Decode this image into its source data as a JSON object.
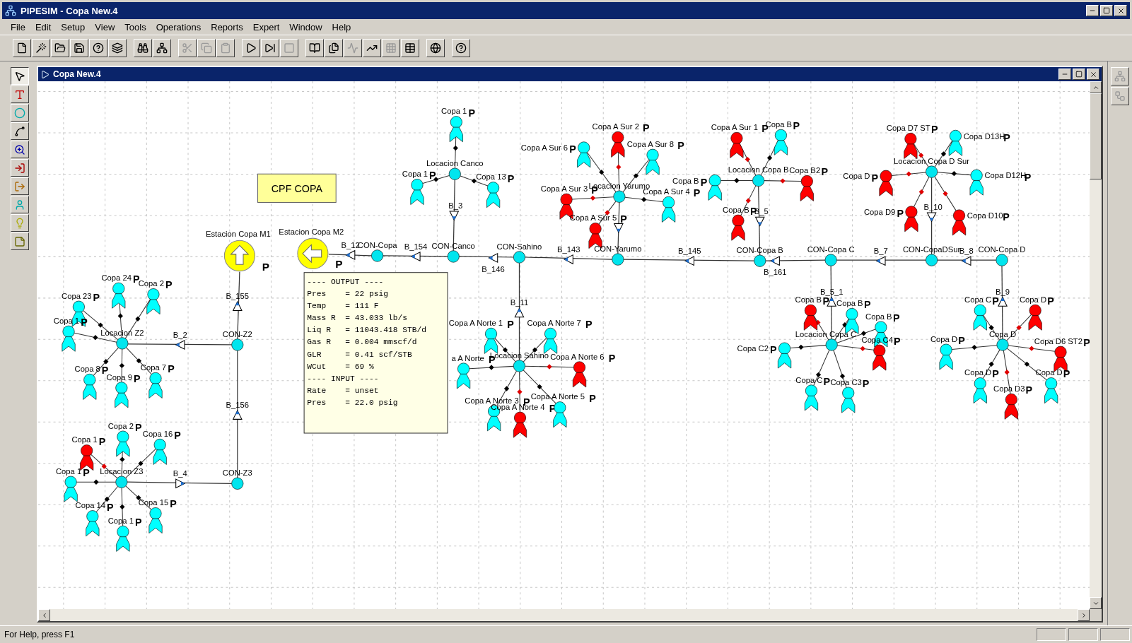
{
  "app_title": "PIPESIM - Copa New.4",
  "menu": [
    "File",
    "Edit",
    "Setup",
    "View",
    "Tools",
    "Operations",
    "Reports",
    "Expert",
    "Window",
    "Help"
  ],
  "toolbar": [
    [
      {
        "kind": "new",
        "disabled": false
      },
      {
        "kind": "wizard",
        "disabled": false
      },
      {
        "kind": "open",
        "disabled": false
      },
      {
        "kind": "save",
        "disabled": false
      },
      {
        "kind": "help-file",
        "disabled": false
      },
      {
        "kind": "layers",
        "disabled": false
      }
    ],
    [
      {
        "kind": "find",
        "disabled": false
      },
      {
        "kind": "network",
        "disabled": false
      }
    ],
    [
      {
        "kind": "cut",
        "disabled": true
      },
      {
        "kind": "copy",
        "disabled": true
      },
      {
        "kind": "paste",
        "disabled": true
      }
    ],
    [
      {
        "kind": "run",
        "disabled": false
      },
      {
        "kind": "run-all",
        "disabled": false
      },
      {
        "kind": "stop",
        "disabled": true
      }
    ],
    [
      {
        "kind": "report",
        "disabled": false
      },
      {
        "kind": "pages",
        "disabled": false
      },
      {
        "kind": "chart",
        "disabled": true
      },
      {
        "kind": "plot",
        "disabled": false
      },
      {
        "kind": "graph",
        "disabled": true
      },
      {
        "kind": "table",
        "disabled": false
      }
    ],
    [
      {
        "kind": "globe",
        "disabled": false
      }
    ],
    [
      {
        "kind": "help",
        "disabled": false
      }
    ]
  ],
  "palette": [
    {
      "kind": "select",
      "selected": true
    },
    {
      "kind": "text",
      "selected": false
    },
    {
      "kind": "node",
      "selected": false
    },
    {
      "kind": "connect",
      "selected": false
    },
    {
      "kind": "zoom",
      "selected": false
    },
    {
      "kind": "source",
      "selected": false
    },
    {
      "kind": "sink",
      "selected": false
    },
    {
      "kind": "well",
      "selected": false
    },
    {
      "kind": "light",
      "selected": false
    },
    {
      "kind": "note",
      "selected": false
    }
  ],
  "right_palette": [
    {
      "kind": "network",
      "disabled": true
    },
    {
      "kind": "tree",
      "disabled": true
    }
  ],
  "document": {
    "title": "Copa New.4",
    "canvas": {
      "note": "CPF COPA",
      "sinks": [
        {
          "label": "Estacion Copa M1",
          "flag": "P",
          "kind": "up"
        },
        {
          "label": "Estacion Copa M2",
          "flag": "P",
          "kind": "left"
        }
      ],
      "junctions": [
        {
          "label": "CON-Copa"
        },
        {
          "label": "CON-Canco"
        },
        {
          "label": "CON-Sahino"
        },
        {
          "label": "CON-Yarumo"
        },
        {
          "label": "CON-Copa B"
        },
        {
          "label": "CON-Copa C"
        },
        {
          "label": "CON-CopaDSur"
        },
        {
          "label": "CON-Copa D"
        },
        {
          "label": "CON-Z2"
        },
        {
          "label": "CON-Z3"
        }
      ],
      "chokes": [
        {
          "label": "B_12"
        },
        {
          "label": "B_154"
        },
        {
          "label": "B_146"
        },
        {
          "label": "B_143"
        },
        {
          "label": "B_145"
        },
        {
          "label": "B_161"
        },
        {
          "label": "B_7"
        },
        {
          "label": "B_8"
        },
        {
          "label": "B_155"
        },
        {
          "label": "B_156"
        },
        {
          "label": "B_2"
        },
        {
          "label": "B_4"
        },
        {
          "label": "B_3"
        },
        {
          "label": "B_11"
        },
        {
          "label": "B_5"
        },
        {
          "label": "B_10"
        },
        {
          "label": "B_5_1"
        },
        {
          "label": "B_9"
        }
      ],
      "clusters": [
        {
          "label": "Locacion Z2",
          "wells": [
            {
              "label": "Copa 24",
              "flag": "P",
              "color": "#00ffff"
            },
            {
              "label": "Copa 2",
              "flag": "P",
              "color": "#00ffff"
            },
            {
              "label": "Copa 23",
              "flag": "P",
              "color": "#00ffff"
            },
            {
              "label": "Copa 1",
              "flag": "P",
              "color": "#00ffff"
            },
            {
              "label": "Copa 8",
              "flag": "P",
              "color": "#00ffff"
            },
            {
              "label": "Copa 9",
              "flag": "P",
              "color": "#00ffff"
            },
            {
              "label": "Copa 7",
              "flag": "P",
              "color": "#00ffff"
            }
          ]
        },
        {
          "label": "Locacion Z3",
          "wells": [
            {
              "label": "Copa 2",
              "flag": "P",
              "color": "#00ffff"
            },
            {
              "label": "Copa 1",
              "flag": "P",
              "color": "#ff0000"
            },
            {
              "label": "Copa 16",
              "flag": "P",
              "color": "#00ffff"
            },
            {
              "label": "Copa 1",
              "flag": "P",
              "color": "#00ffff"
            },
            {
              "label": "Copa 14",
              "flag": "P",
              "color": "#00ffff"
            },
            {
              "label": "Copa 1",
              "flag": "P",
              "color": "#00ffff"
            },
            {
              "label": "Copa 15",
              "flag": "P",
              "color": "#00ffff"
            }
          ]
        },
        {
          "label": "Locacion Canco",
          "wells": [
            {
              "label": "Copa 1",
              "flag": "P",
              "color": "#00ffff"
            },
            {
              "label": "Copa 1",
              "flag": "P",
              "color": "#00ffff"
            },
            {
              "label": "Copa 13",
              "flag": "P",
              "color": "#00ffff"
            }
          ]
        },
        {
          "label": "Locacion Yarumo",
          "wells": [
            {
              "label": "Copa A Sur 6",
              "flag": "P",
              "color": "#00ffff"
            },
            {
              "label": "Copa A Sur 2",
              "flag": "P",
              "color": "#ff0000"
            },
            {
              "label": "Copa A Sur 8",
              "flag": "P",
              "color": "#00ffff"
            },
            {
              "label": "Copa A Sur 3",
              "flag": "P",
              "color": "#ff0000"
            },
            {
              "label": "Copa A Sur 4",
              "flag": "P",
              "color": "#00ffff"
            },
            {
              "label": "Copa A Sur 5",
              "flag": "P",
              "color": "#ff0000"
            }
          ]
        },
        {
          "label": "Locacion Copa B",
          "wells": [
            {
              "label": "Copa A Sur 1",
              "flag": "P",
              "color": "#ff0000"
            },
            {
              "label": "Copa B",
              "flag": "P",
              "color": "#00ffff"
            },
            {
              "label": "Copa B",
              "flag": "P",
              "color": "#00ffff"
            },
            {
              "label": "Copa B2",
              "flag": "P",
              "color": "#ff0000"
            },
            {
              "label": "Copa B",
              "flag": "P",
              "color": "#ff0000"
            }
          ]
        },
        {
          "label": "Locacion Copa D Sur",
          "wells": [
            {
              "label": "Copa D7 ST",
              "flag": "P",
              "color": "#ff0000"
            },
            {
              "label": "Copa D13H",
              "flag": "P",
              "color": "#00ffff"
            },
            {
              "label": "Copa D",
              "flag": "P",
              "color": "#ff0000"
            },
            {
              "label": "Copa D12H",
              "flag": "P",
              "color": "#00ffff"
            },
            {
              "label": "Copa D9",
              "flag": "P",
              "color": "#ff0000"
            },
            {
              "label": "Copa D10",
              "flag": "P",
              "color": "#ff0000"
            }
          ]
        },
        {
          "label": "Locacion Copa C",
          "wells": [
            {
              "label": "Copa B",
              "flag": "P",
              "color": "#ff0000"
            },
            {
              "label": "Copa B",
              "flag": "P",
              "color": "#00ffff"
            },
            {
              "label": "Copa B",
              "flag": "P",
              "color": "#00ffff"
            },
            {
              "label": "Copa C4",
              "flag": "P",
              "color": "#ff0000"
            },
            {
              "label": "Copa C2",
              "flag": "P",
              "color": "#00ffff"
            },
            {
              "label": "Copa C",
              "flag": "P",
              "color": "#00ffff"
            },
            {
              "label": "Copa C3",
              "flag": "P",
              "color": "#00ffff"
            }
          ]
        },
        {
          "label": "Copa D",
          "wells": [
            {
              "label": "Copa C",
              "flag": "P",
              "color": "#00ffff"
            },
            {
              "label": "Copa D",
              "flag": "P",
              "color": "#ff0000"
            },
            {
              "label": "Copa D",
              "flag": "P",
              "color": "#00ffff"
            },
            {
              "label": "Copa D6 ST2",
              "flag": "P",
              "color": "#ff0000"
            },
            {
              "label": "Copa D",
              "flag": "P",
              "color": "#00ffff"
            },
            {
              "label": "Copa D3",
              "flag": "P",
              "color": "#ff0000"
            },
            {
              "label": "Copa D",
              "flag": "P",
              "color": "#00ffff"
            }
          ]
        },
        {
          "label": "Locacion Sahino",
          "wells": [
            {
              "label": "Copa A Norte 1",
              "flag": "P",
              "color": "#00ffff"
            },
            {
              "label": "Copa A Norte 7",
              "flag": "P",
              "color": "#00ffff"
            },
            {
              "label": "a A Norte",
              "flag": "P",
              "color": "#00ffff"
            },
            {
              "label": "Copa A Norte 6",
              "flag": "P",
              "color": "#ff0000"
            },
            {
              "label": "Copa A Norte 3",
              "flag": "P",
              "color": "#00ffff"
            },
            {
              "label": "Copa A Norte 4",
              "flag": "P",
              "color": "#ff0000"
            },
            {
              "label": "Copa A Norte 5",
              "flag": "P",
              "color": "#00ffff"
            }
          ]
        }
      ],
      "output_box": {
        "lines": [
          "---- OUTPUT ----",
          "Pres    = 22 psig",
          "Temp    = 111 F",
          "Mass R  = 43.033 lb/s",
          "Liq R   = 11043.418 STB/d",
          "Gas R   = 0.004 mmscf/d",
          "GLR     = 0.41 scf/STB",
          "WCut    = 69 %",
          "---- INPUT ----",
          "Rate    = unset",
          "Pres    = 22.0 psig"
        ]
      }
    }
  },
  "status_bar": "For Help, press F1"
}
